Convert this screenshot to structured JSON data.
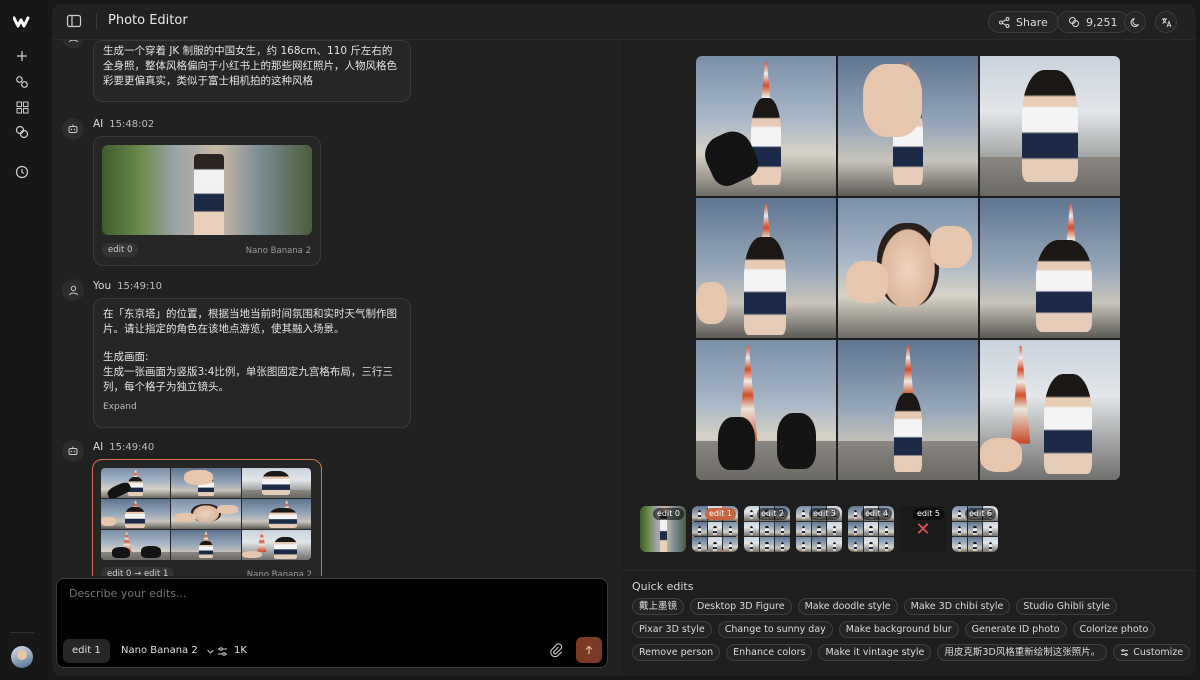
{
  "app": {
    "title": "Photo Editor",
    "share_label": "Share",
    "credits": "9,251"
  },
  "colors": {
    "accent": "#d4744e",
    "failed": "#e05252",
    "background": "#171717",
    "panel": "#212121"
  },
  "icons": [
    "logo-icon",
    "plus-icon",
    "link-icon",
    "grid-icon",
    "coins-icon",
    "history-icon",
    "sidebar-toggle-icon",
    "share-icon",
    "credits-icon",
    "moon-icon",
    "translate-icon",
    "bot-icon",
    "user-icon",
    "paperclip-icon",
    "send-icon",
    "sliders-icon",
    "chevron-down-icon",
    "close-icon"
  ],
  "messages": [
    {
      "role": "You",
      "text": "生成一个穿着 JK 制服的中国女生，约 168cm、110 斤左右的全身照，整体风格偏向于小红书上的那些网红照片，人物风格色彩要更偏真实，类似于富士相机拍的这种风格"
    },
    {
      "role": "AI",
      "time": "15:48:02",
      "edit_tag": "edit 0",
      "model": "Nano Banana 2"
    },
    {
      "role": "You",
      "time": "15:49:10",
      "lines": [
        "在「东京塔」的位置，根据当地当前时间氛围和实时天气制作图片。请让指定的角色在该地点游览，使其融入场景。",
        "",
        "生成画面:",
        "生成一张画面为竖版3:4比例，单张图固定九宫格布局，三行三列，每个格子为独立镜头。"
      ],
      "expand_label": "Expand"
    },
    {
      "role": "AI",
      "time": "15:49:40",
      "edit_tag": "edit 0 → edit 1",
      "model": "Nano Banana 2"
    }
  ],
  "composer": {
    "placeholder": "Describe your edits...",
    "edit_label": "edit 1",
    "model": "Nano Banana 2",
    "resolution": "1K"
  },
  "history": [
    {
      "label": "edit 0",
      "status": "ok",
      "selected": false
    },
    {
      "label": "edit 1",
      "status": "ok",
      "selected": true
    },
    {
      "label": "edit 2",
      "status": "ok",
      "selected": false
    },
    {
      "label": "edit 3",
      "status": "ok",
      "selected": false
    },
    {
      "label": "edit 4",
      "status": "ok",
      "selected": false
    },
    {
      "label": "edit 5",
      "status": "failed",
      "selected": false
    },
    {
      "label": "edit 6",
      "status": "ok",
      "selected": false
    }
  ],
  "quick_edits": {
    "title": "Quick edits",
    "items": [
      "戴上墨镜",
      "Desktop 3D Figure",
      "Make doodle style",
      "Make 3D chibi style",
      "Studio Ghibli style",
      "Pixar 3D style",
      "Change to sunny day",
      "Make background blur",
      "Generate ID photo",
      "Colorize photo",
      "Remove person",
      "Enhance colors",
      "Make it vintage style",
      "用皮克斯3D风格重新绘制这张照片。"
    ],
    "customize_label": "Customize"
  }
}
